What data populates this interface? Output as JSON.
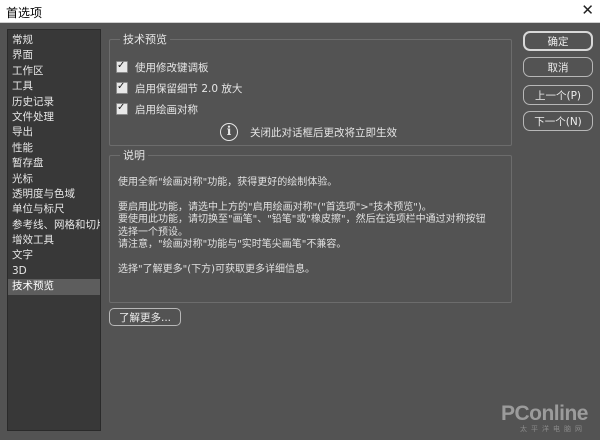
{
  "window": {
    "title": "首选项",
    "close_glyph": "✕"
  },
  "sidebar": {
    "items": [
      {
        "label": "常规"
      },
      {
        "label": "界面"
      },
      {
        "label": "工作区"
      },
      {
        "label": "工具"
      },
      {
        "label": "历史记录"
      },
      {
        "label": "文件处理"
      },
      {
        "label": "导出"
      },
      {
        "label": "性能"
      },
      {
        "label": "暂存盘"
      },
      {
        "label": "光标"
      },
      {
        "label": "透明度与色域"
      },
      {
        "label": "单位与标尺"
      },
      {
        "label": "参考线、网格和切片"
      },
      {
        "label": "增效工具"
      },
      {
        "label": "文字"
      },
      {
        "label": "3D"
      },
      {
        "label": "技术预览"
      }
    ],
    "active_index": 16
  },
  "tech_preview": {
    "legend": "技术预览",
    "checkboxes": [
      {
        "label": "使用修改键调板",
        "checked": true
      },
      {
        "label": "启用保留细节 2.0 放大",
        "checked": true
      },
      {
        "label": "启用绘画对称",
        "checked": true
      }
    ],
    "check_glyph": "✓",
    "info_icon": "info-icon",
    "info_glyph": "i",
    "info_text": "关闭此对话框后更改将立即生效"
  },
  "description": {
    "legend": "说明",
    "para1": "使用全新\"绘画对称\"功能，获得更好的绘制体验。",
    "para2_line1": "要启用此功能，请选中上方的\"启用绘画对称\"(\"首选项\">\"技术预览\")。",
    "para2_line2": "要使用此功能，请切换至\"画笔\"、\"铅笔\"或\"橡皮擦\"，然后在选项栏中通过对称按钮",
    "para2_line3": "选择一个预设。",
    "para2_line4": "请注意，\"绘画对称\"功能与\"实时笔尖画笔\"不兼容。",
    "para3": "选择\"了解更多\"(下方)可获取更多详细信息。"
  },
  "buttons": {
    "ok": "确定",
    "cancel": "取消",
    "prev": "上一个(P)",
    "next": "下一个(N)",
    "learn_more": "了解更多..."
  },
  "watermark": {
    "brand": "PConline",
    "sub": "太平洋电脑网"
  }
}
